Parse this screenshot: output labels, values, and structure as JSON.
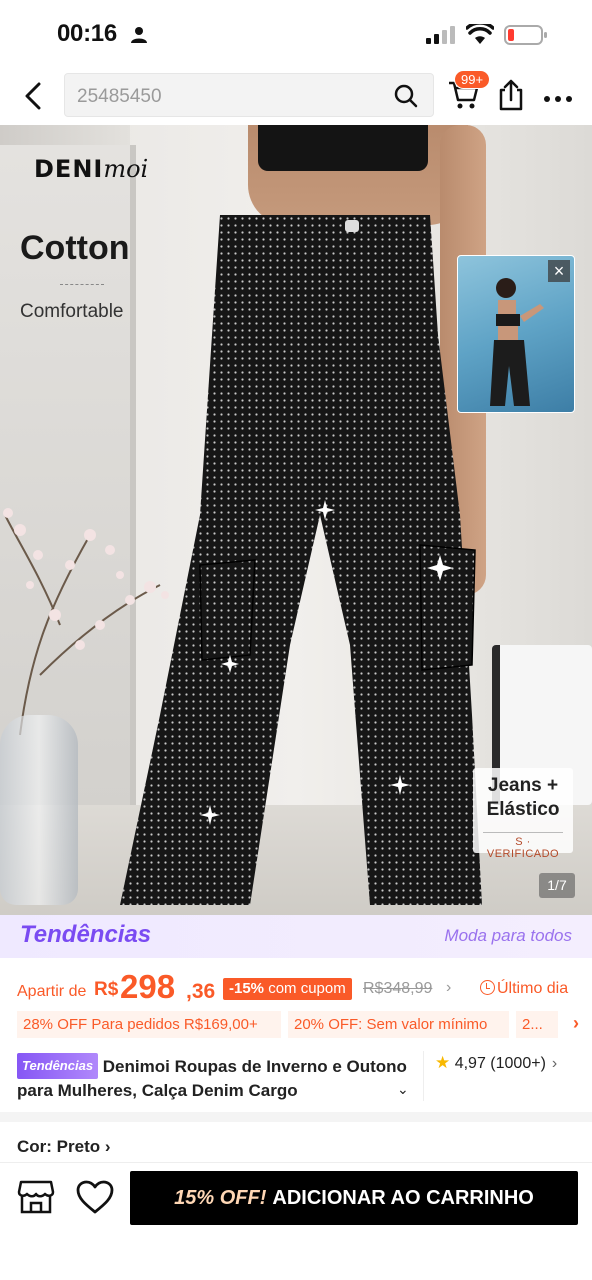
{
  "status_bar": {
    "time": "00:16"
  },
  "top_nav": {
    "search_text": "25485450",
    "cart_badge": "99+"
  },
  "hero": {
    "brand_logo_bold": "DENI",
    "brand_logo_script": "moi",
    "heading": "Cotton",
    "subheading": "Comfortable",
    "badge_line1": "Jeans +",
    "badge_line2": "Elástico",
    "badge_verified": "S · VERIFICADO",
    "counter": "1/7",
    "thumbnail_close": "×"
  },
  "trend_banner": {
    "logo": "Tendências",
    "tagline": "Moda para todos"
  },
  "price": {
    "prefix": "Apartir de",
    "currency": "R$",
    "integer": "298",
    "decimal": ",36",
    "discount_percent": "-15%",
    "discount_text": "com cupom",
    "old_price": "R$348,99",
    "old_price_arrow": "›",
    "last_day": "Último dia"
  },
  "coupons": [
    "28% OFF Para pedidos R$169,00+",
    "20% OFF: Sem valor mínimo",
    "2..."
  ],
  "coupon_arrow": "›",
  "product": {
    "tag": "Tendências",
    "title": "Denimoi Roupas de Inverno e Outono para Mulheres, Calça Denim Cargo",
    "rating": "4,97",
    "rating_count": "(1000+)",
    "rating_arrow": "›",
    "title_chevron": "⌄"
  },
  "color_row": {
    "label": "Cor: Preto",
    "arrow": "›"
  },
  "bottom_bar": {
    "promo": "15% OFF!",
    "add_to_cart": "ADICIONAR AO CARRINHO"
  },
  "colors": {
    "accent": "#fa5a28",
    "trend_purple": "#7a4bf2",
    "button_black": "#000000"
  }
}
